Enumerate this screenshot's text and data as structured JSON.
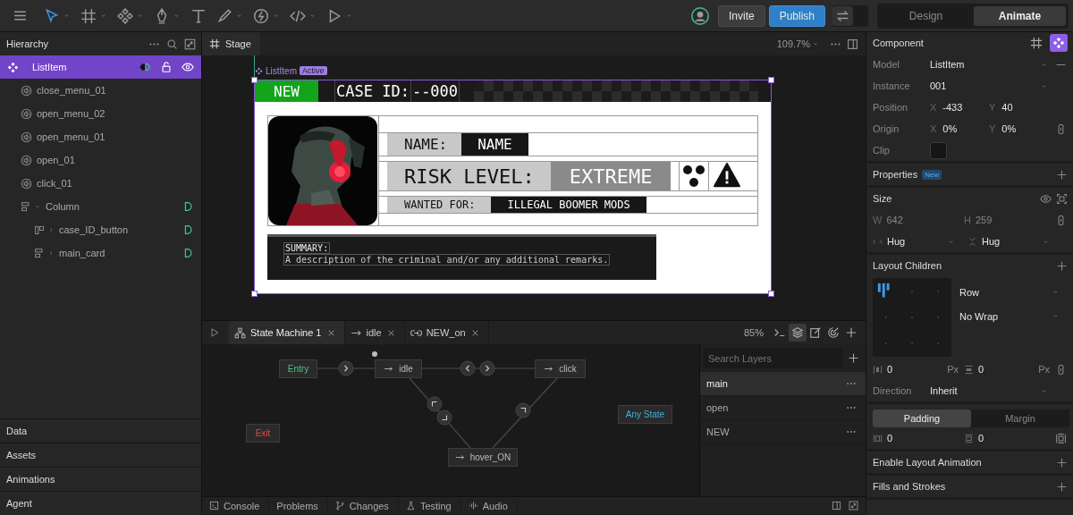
{
  "toolbar": {
    "tools": [
      {
        "kind": "select",
        "selected": true,
        "has_menu": true
      },
      {
        "kind": "frame",
        "selected": false,
        "has_menu": true
      },
      {
        "kind": "component",
        "selected": false,
        "has_menu": true
      },
      {
        "kind": "pen",
        "selected": false,
        "has_menu": true
      },
      {
        "kind": "text",
        "selected": false,
        "has_menu": false
      },
      {
        "kind": "brush",
        "selected": false,
        "has_menu": true
      },
      {
        "kind": "bolt",
        "selected": false,
        "has_menu": true
      },
      {
        "kind": "code",
        "selected": false,
        "has_menu": true
      },
      {
        "kind": "play",
        "selected": false,
        "has_menu": true
      }
    ],
    "invite": "Invite",
    "publish": "Publish",
    "modes": [
      {
        "label": "Design",
        "selected": false
      },
      {
        "label": "Animate",
        "selected": true
      }
    ]
  },
  "hierarchy": {
    "title": "Hierarchy",
    "items": [
      {
        "label": "ListItem",
        "kind": "component",
        "selected": true,
        "expanded": true,
        "children": [
          {
            "label": "close_menu_01",
            "kind": "audio",
            "selected": false
          },
          {
            "label": "open_menu_02",
            "kind": "audio",
            "selected": false
          },
          {
            "label": "open_menu_01",
            "kind": "audio",
            "selected": false
          },
          {
            "label": "open_01",
            "kind": "audio",
            "selected": false
          },
          {
            "label": "click_01",
            "kind": "audio",
            "selected": false
          },
          {
            "label": "Column",
            "kind": "column",
            "selected": false,
            "expanded": true,
            "children": [
              {
                "label": "case_ID_button",
                "kind": "row",
                "selected": false,
                "expanded": false
              },
              {
                "label": "main_card",
                "kind": "column",
                "selected": false,
                "expanded": false
              }
            ]
          }
        ]
      }
    ]
  },
  "left_sections": [
    "Data",
    "Assets",
    "Animations",
    "Agent"
  ],
  "stage": {
    "tab": "Stage",
    "zoom": "109.7%",
    "selection": {
      "name": "ListItem",
      "badge": "Active"
    },
    "card": {
      "status": "NEW",
      "case_label": "CASE ID:",
      "case_value": "--000",
      "name_label": "NAME:",
      "name_value": "NAME",
      "risk_label": "RISK LEVEL:",
      "risk_value": "EXTREME",
      "wanted_label": "WANTED FOR:",
      "wanted_value": "ILLEGAL BOOMER MODS",
      "summary_label": "SUMMARY:",
      "summary_text": "A description of the criminal and/or any additional remarks."
    }
  },
  "state_machine": {
    "tabs": [
      {
        "label": "State Machine 1",
        "kind": "machine",
        "selected": true
      },
      {
        "label": "idle",
        "kind": "oneshot",
        "selected": false
      },
      {
        "label": "NEW_on",
        "kind": "loop",
        "selected": false
      }
    ],
    "zoom": "85%",
    "nodes": [
      {
        "label": "Entry",
        "kind": "entry"
      },
      {
        "label": "idle",
        "kind": "state"
      },
      {
        "label": "click",
        "kind": "state"
      },
      {
        "label": "Exit",
        "kind": "exit"
      },
      {
        "label": "Any State",
        "kind": "any"
      },
      {
        "label": "hover_ON",
        "kind": "state"
      }
    ],
    "layers": {
      "placeholder": "Search Layers",
      "items": [
        {
          "label": "main",
          "selected": true
        },
        {
          "label": "open",
          "selected": false
        },
        {
          "label": "NEW",
          "selected": false
        }
      ]
    }
  },
  "console_tabs": [
    {
      "label": "Console",
      "kind": "console"
    },
    {
      "label": "Problems",
      "kind": "problems"
    },
    {
      "label": "Changes",
      "kind": "changes"
    },
    {
      "label": "Testing",
      "kind": "testing"
    },
    {
      "label": "Audio",
      "kind": "audio"
    }
  ],
  "inspector": {
    "title": "Component",
    "rows": [
      {
        "kind": "select",
        "label": "Model",
        "value": "ListItem",
        "removable": true
      },
      {
        "kind": "select",
        "label": "Instance",
        "value": "001",
        "removable": false
      },
      {
        "kind": "pair",
        "label": "Position",
        "fields": [
          {
            "axis": "X",
            "value": "-433"
          },
          {
            "axis": "Y",
            "value": "40"
          }
        ],
        "linkable": false
      },
      {
        "kind": "pair",
        "label": "Origin",
        "fields": [
          {
            "axis": "X",
            "value": "0%"
          },
          {
            "axis": "Y",
            "value": "0%"
          }
        ],
        "linkable": true
      },
      {
        "kind": "toggle",
        "label": "Clip",
        "checked": false
      }
    ],
    "properties": {
      "title": "Properties",
      "badge": "New"
    },
    "size": {
      "title": "Size",
      "fields": [
        {
          "axis": "W",
          "value": "642"
        },
        {
          "axis": "H",
          "value": "259"
        }
      ],
      "modes": [
        "Hug",
        "Hug"
      ]
    },
    "layout": {
      "title": "Layout Children",
      "flow": "Row",
      "wrap": "No Wrap",
      "gaps": [
        {
          "value": "0",
          "unit": "Px"
        },
        {
          "value": "0",
          "unit": "Px"
        }
      ],
      "direction_label": "Direction",
      "direction": "Inherit"
    },
    "spacing": {
      "tabs": [
        {
          "label": "Padding",
          "selected": true
        },
        {
          "label": "Margin",
          "selected": false
        }
      ],
      "values": [
        "0",
        "0"
      ]
    },
    "layout_animation": "Enable Layout Animation",
    "next_section": "Fills and Strokes"
  }
}
